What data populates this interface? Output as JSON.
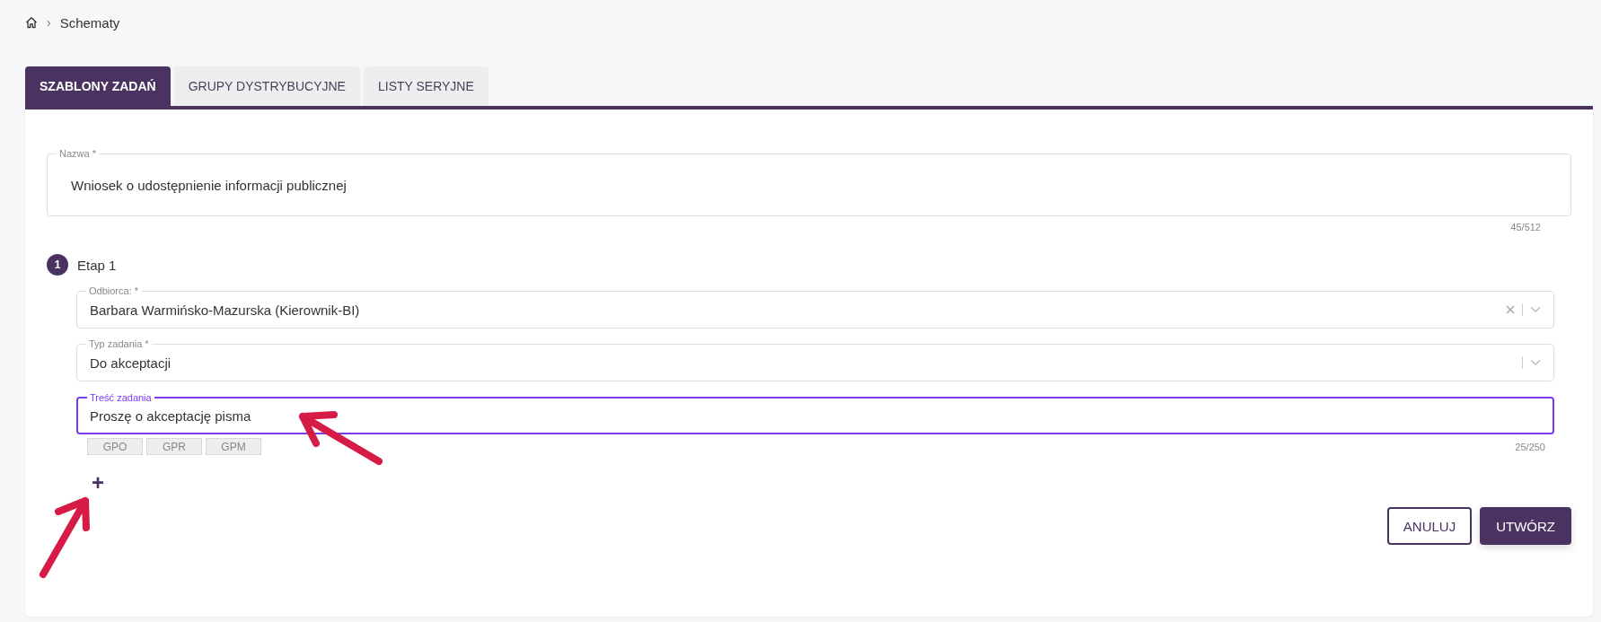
{
  "breadcrumb": {
    "separator": "›",
    "current": "Schematy"
  },
  "tabs": [
    {
      "label": "SZABLONY ZADAŃ",
      "selected": true
    },
    {
      "label": "GRUPY DYSTRYBUCYJNE",
      "selected": false
    },
    {
      "label": "LISTY SERYJNE",
      "selected": false
    }
  ],
  "name_field": {
    "label": "Nazwa *",
    "value": "Wniosek o udostępnienie informacji publicznej",
    "counter": "45/512"
  },
  "stages": [
    {
      "number": "1",
      "title": "Etap 1",
      "fields": [
        {
          "kind": "select",
          "label": "Odbiorca: *",
          "value": "Barbara Warmińsko-Mazurska (Kierownik-BI)",
          "clearable": true,
          "focused": false
        },
        {
          "kind": "select",
          "label": "Typ zadania *",
          "value": "Do akceptacji",
          "clearable": false,
          "focused": false
        },
        {
          "kind": "text",
          "label": "Treść zadania",
          "value": "Proszę o akceptację pisma",
          "focused": true,
          "counter": "25/250",
          "chips": [
            "GPO",
            "GPR",
            "GPM"
          ]
        }
      ]
    }
  ],
  "add_stage": "+",
  "buttons": [
    {
      "label": "ANULUJ",
      "kind": "secondary"
    },
    {
      "label": "UTWÓRZ",
      "kind": "primary"
    }
  ]
}
